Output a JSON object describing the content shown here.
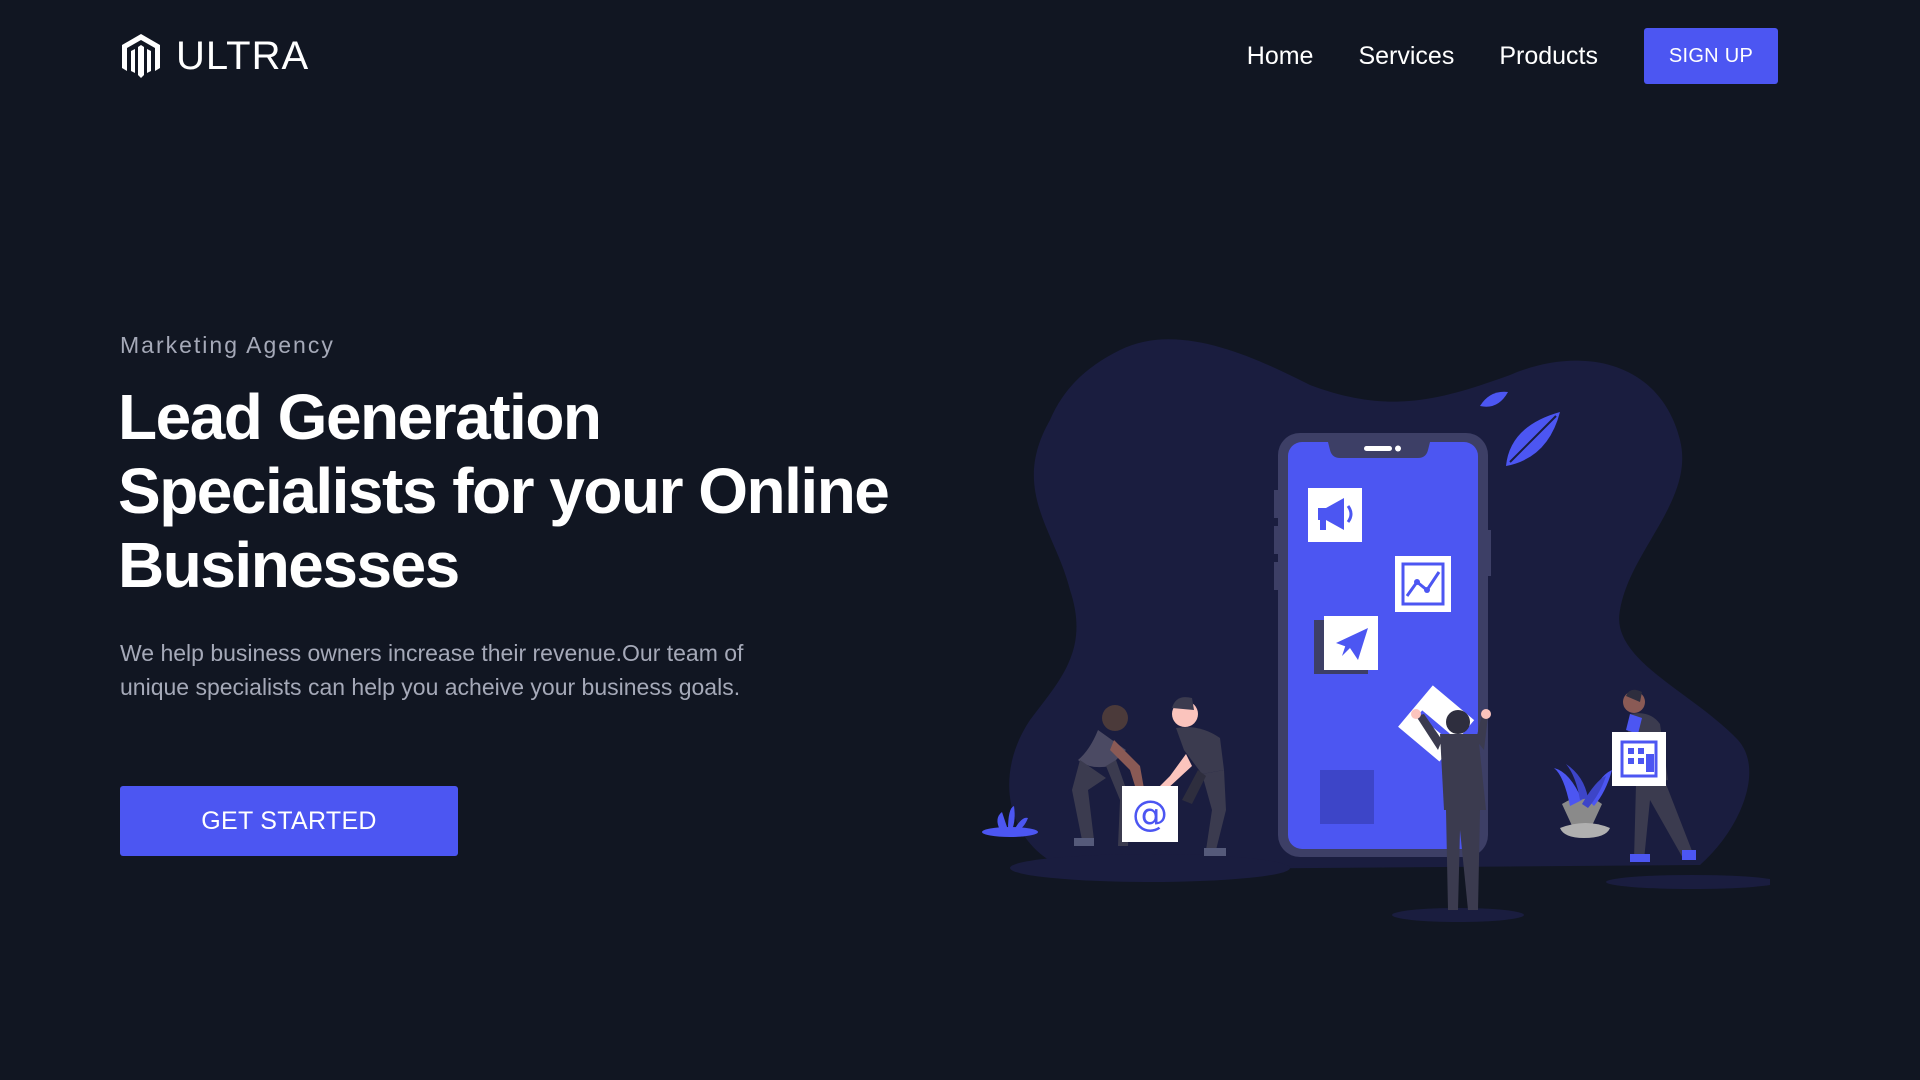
{
  "brand": {
    "name": "ULTRA",
    "logo_icon": "magento-hexagon-m-logo"
  },
  "nav": {
    "links": [
      {
        "label": "Home"
      },
      {
        "label": "Services"
      },
      {
        "label": "Products"
      }
    ],
    "signup_label": "SIGN UP"
  },
  "hero": {
    "eyebrow": "Marketing Agency",
    "headline_lines": [
      "Lead Generation",
      "Specialists for your Online",
      "Businesses"
    ],
    "description": "We help business owners increase their revenue.Our team of unique specialists can help you acheive your business goals.",
    "cta_label": "GET STARTED"
  },
  "illustration": {
    "icons": [
      "megaphone-icon",
      "line-chart-icon",
      "paper-plane-icon",
      "email-at-icon",
      "building-icon",
      "diagonal-line-icon"
    ],
    "at_symbol": "@"
  },
  "colors": {
    "background": "#111622",
    "accent": "#4c56f2",
    "muted_text": "#a5a9b8",
    "blob": "#1a1d3f"
  }
}
